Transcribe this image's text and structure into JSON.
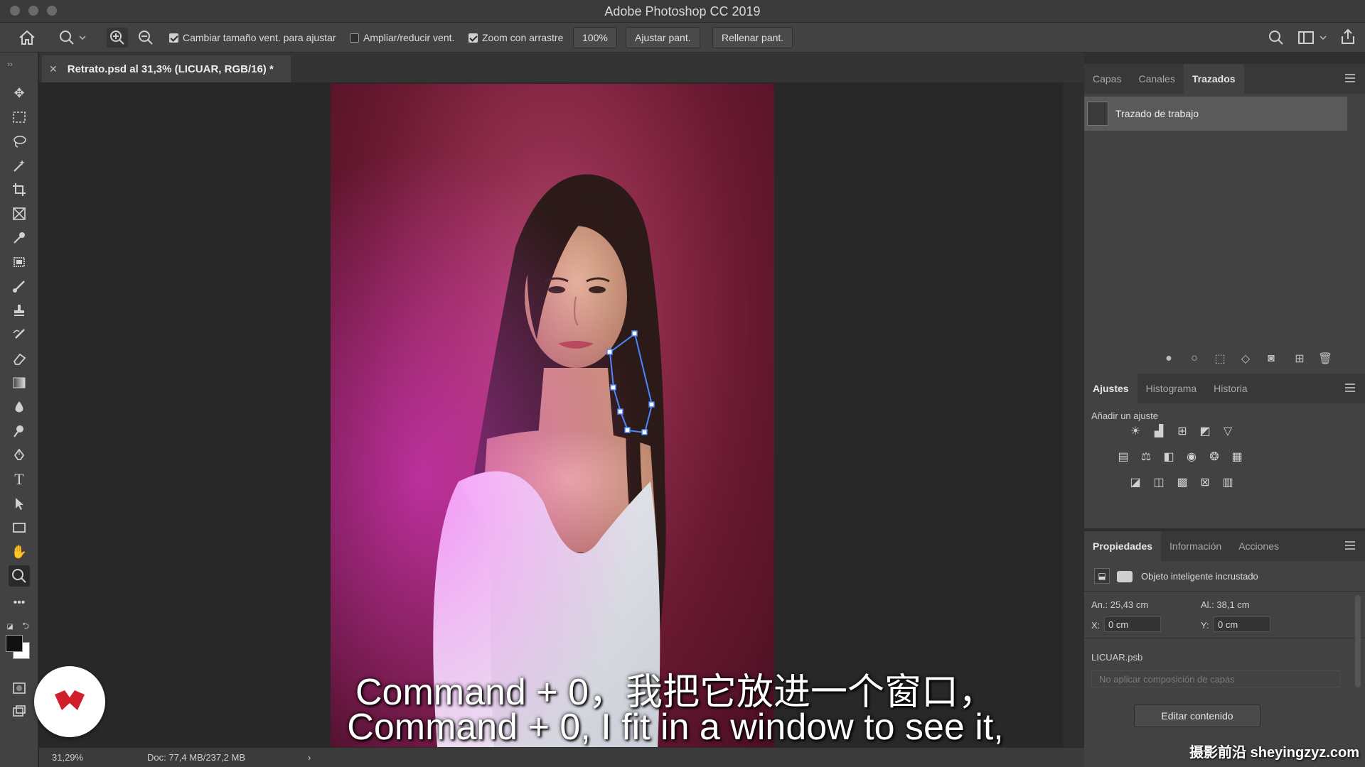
{
  "window": {
    "title": "Adobe Photoshop CC 2019"
  },
  "options_bar": {
    "chk_resize": "Cambiar tamaño vent. para ajustar",
    "chk_zoom_all": "Ampliar/reducir vent.",
    "chk_scrubby": "Zoom con arrastre",
    "zoom_value": "100%",
    "fit_screen": "Ajustar pant.",
    "fill_screen": "Rellenar pant."
  },
  "document": {
    "tab_title": "Retrato.psd al 31,3% (LICUAR, RGB/16) *"
  },
  "status": {
    "zoom": "31,29%",
    "doc": "Doc: 77,4 MB/237,2 MB",
    "arrow": "›"
  },
  "paths_panel": {
    "tabs": [
      "Capas",
      "Canales",
      "Trazados"
    ],
    "work_path": "Trazado de trabajo"
  },
  "adjustments_panel": {
    "tabs": [
      "Ajustes",
      "Histograma",
      "Historia"
    ],
    "add_label": "Añadir un ajuste"
  },
  "properties_panel": {
    "tabs": [
      "Propiedades",
      "Información",
      "Acciones"
    ],
    "kind": "Objeto inteligente incrustado",
    "w_label": "An.: 25,43 cm",
    "h_label": "Al.: 38,1 cm",
    "x_label": "X:",
    "x_value": "0 cm",
    "y_label": "Y:",
    "y_value": "0 cm",
    "file": "LICUAR.psb",
    "comp": "No aplicar composición de capas",
    "edit_btn": "Editar contenido"
  },
  "subtitles": {
    "zh": "Command + 0，我把它放进一个窗口，",
    "en": "Command + 0, I fit in a window to see it,"
  },
  "watermark": "摄影前沿 sheyingzyz.com"
}
